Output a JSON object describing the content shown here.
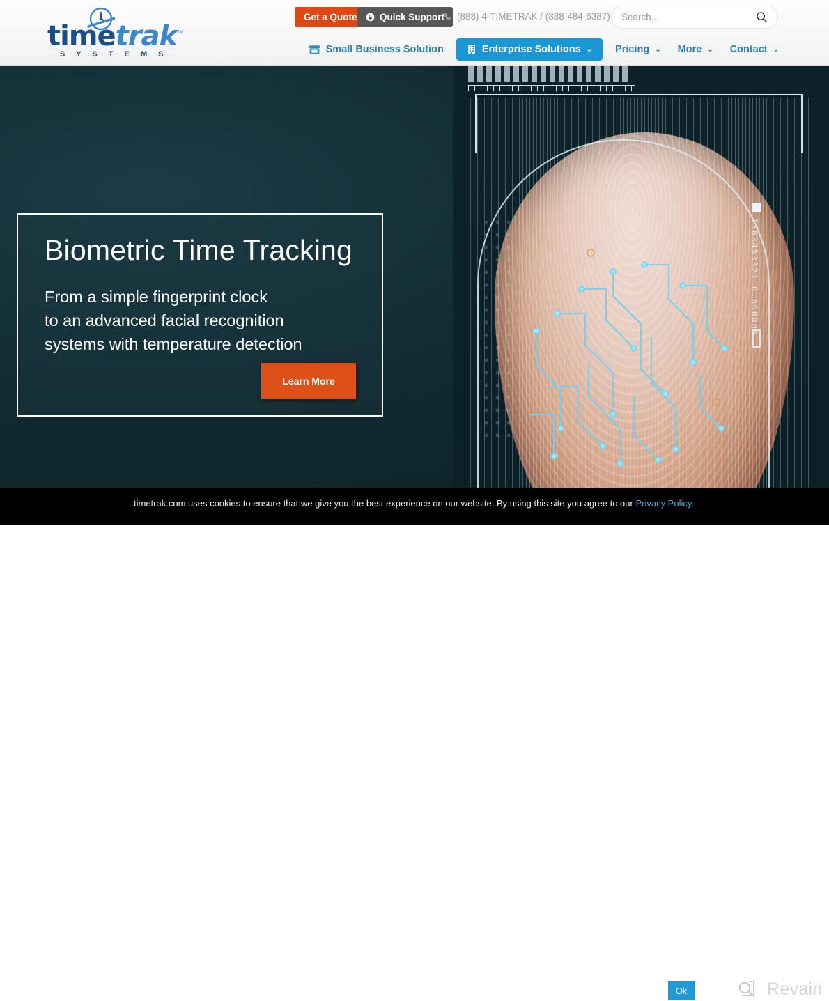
{
  "header": {
    "logo": {
      "part1": "time",
      "part2": "trak",
      "tagline": "S Y S T E M S",
      "trademark": "™",
      "icon": "clock-icon"
    },
    "quote_button": "Get a Quote",
    "support_button": "Quick Support",
    "support_icon": "lock-icon",
    "phone_icon": "phone-icon",
    "phone": "(888) 4-TIMETRAK / (888-484-6387)",
    "search": {
      "placeholder": "Search...",
      "value": "",
      "icon": "search-icon"
    }
  },
  "nav": {
    "items": [
      {
        "label": "Small Business Solution",
        "icon": "store-icon",
        "active": false,
        "caret": ""
      },
      {
        "label": "Enterprise Solutions",
        "icon": "building-icon",
        "active": true,
        "caret": "⌄"
      },
      {
        "label": "Pricing",
        "icon": "",
        "active": false,
        "caret": "⌄"
      },
      {
        "label": "More",
        "icon": "",
        "active": false,
        "caret": "⌄"
      },
      {
        "label": "Contact",
        "icon": "",
        "active": false,
        "caret": "⌄"
      }
    ]
  },
  "hero": {
    "title": "Biometric Time Tracking",
    "subtitle_line1": "From a simple fingerprint clock",
    "subtitle_line2": "to an advanced facial recognition",
    "subtitle_line3": "systems with temperature detection",
    "cta": "Learn More",
    "image": {
      "alt": "fingerprint-biometric-scanner",
      "code_readout": "1363453321 0.600000"
    }
  },
  "cookie_banner": {
    "message": "timetrak.com uses cookies to ensure that we give you the best experience on our website. By using this site you agree to our ",
    "link": "Privacy Policy.",
    "accept": "Ok"
  },
  "watermark": {
    "label": "Revain",
    "icon": "revain-logo-icon"
  },
  "colors": {
    "accent_orange": "#dd4814",
    "accent_blue": "#1b97d5",
    "nav_link": "#2c7fa8",
    "support_gray": "#575757",
    "hero_bg": "#122c34",
    "cookie_bg": "#000000",
    "ok_button": "#1e9ad6"
  }
}
